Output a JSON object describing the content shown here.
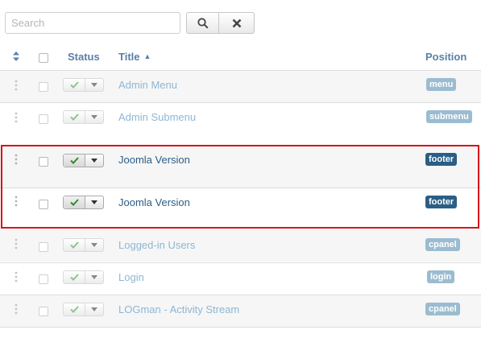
{
  "search": {
    "placeholder": "Search",
    "value": ""
  },
  "toolbar": {
    "search_icon": "search-icon",
    "clear_icon": "close-icon"
  },
  "header": {
    "status": "Status",
    "title": "Title",
    "title_sort_caret": "▲",
    "position": "Position"
  },
  "colors": {
    "link_faded": "#8fb6d3",
    "link_active": "#2a5d86",
    "badge_faded": "#9bbcd0",
    "badge_active": "#2b5e85",
    "check_active": "#2e8b2e",
    "check_faded": "#8dc58d",
    "highlight_border": "#d8141b"
  },
  "rows": [
    {
      "title": "Admin Menu",
      "position": "menu",
      "published": true,
      "highlighted": false
    },
    {
      "title": "Admin Submenu",
      "position": "submenu",
      "published": true,
      "highlighted": false
    },
    {
      "title": "Joomla Version",
      "position": "footer",
      "published": true,
      "highlighted": true
    },
    {
      "title": "Joomla Version",
      "position": "footer",
      "published": true,
      "highlighted": true
    },
    {
      "title": "Logged-in Users",
      "position": "cpanel",
      "published": true,
      "highlighted": false
    },
    {
      "title": "Login",
      "position": "login",
      "published": true,
      "highlighted": false
    },
    {
      "title": "LOGman - Activity Stream",
      "position": "cpanel",
      "published": true,
      "highlighted": false
    }
  ]
}
